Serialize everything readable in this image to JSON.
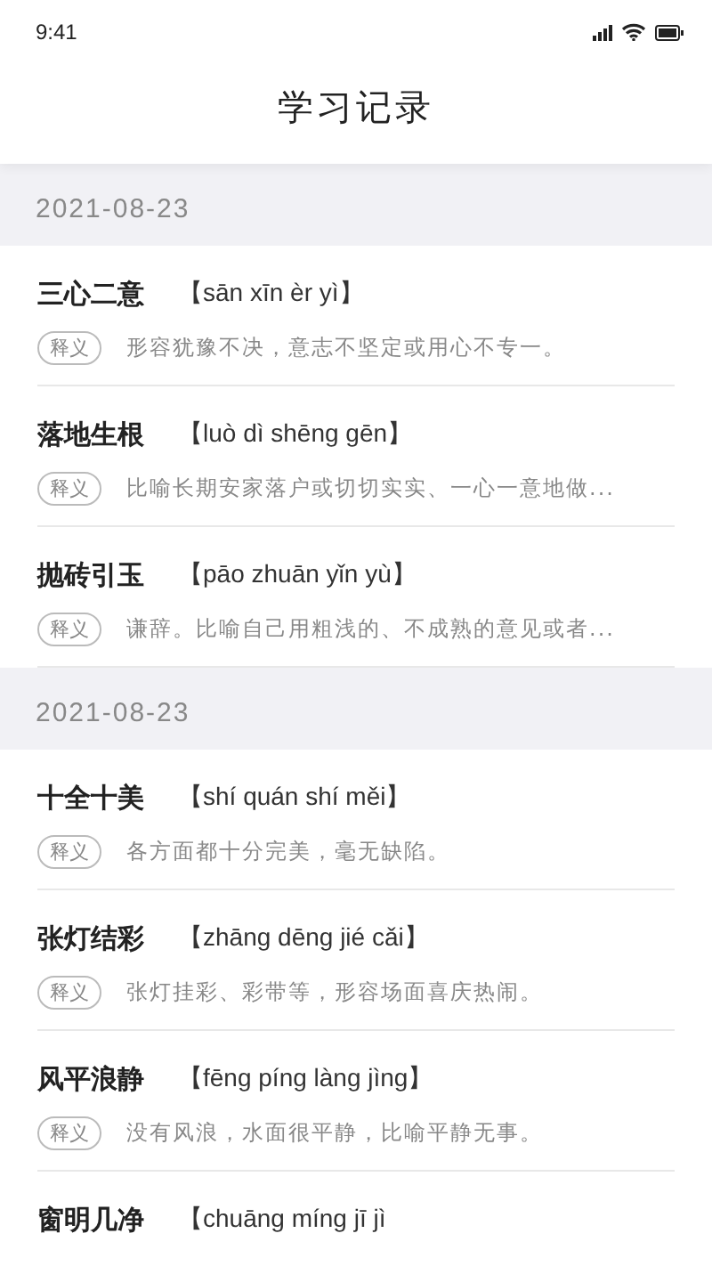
{
  "status_bar": {
    "time": "9:41"
  },
  "header": {
    "title": "学习记录"
  },
  "groups": [
    {
      "date": "2021-08-23",
      "entries": [
        {
          "word": "三心二意",
          "pinyin": "【sān xīn èr yì】",
          "tag": "释义",
          "definition": "形容犹豫不决，意志不坚定或用心不专一。"
        },
        {
          "word": "落地生根",
          "pinyin": "【luò dì shēng gēn】",
          "tag": "释义",
          "definition": "比喻长期安家落户或切切实实、一心一意地做..."
        },
        {
          "word": "抛砖引玉",
          "pinyin": "【pāo zhuān yǐn yù】",
          "tag": "释义",
          "definition": "谦辞。比喻自己用粗浅的、不成熟的意见或者..."
        }
      ]
    },
    {
      "date": "2021-08-23",
      "entries": [
        {
          "word": "十全十美",
          "pinyin": "【shí quán shí měi】",
          "tag": "释义",
          "definition": "各方面都十分完美，毫无缺陷。"
        },
        {
          "word": "张灯结彩",
          "pinyin": "【zhāng dēng jié cǎi】",
          "tag": "释义",
          "definition": "张灯挂彩、彩带等，形容场面喜庆热闹。"
        },
        {
          "word": "风平浪静",
          "pinyin": "【fēng píng làng jìng】",
          "tag": "释义",
          "definition": "没有风浪，水面很平静，比喻平静无事。"
        },
        {
          "word": "窗明几净",
          "pinyin": "【chuāng míng jī jì"
        }
      ]
    }
  ]
}
